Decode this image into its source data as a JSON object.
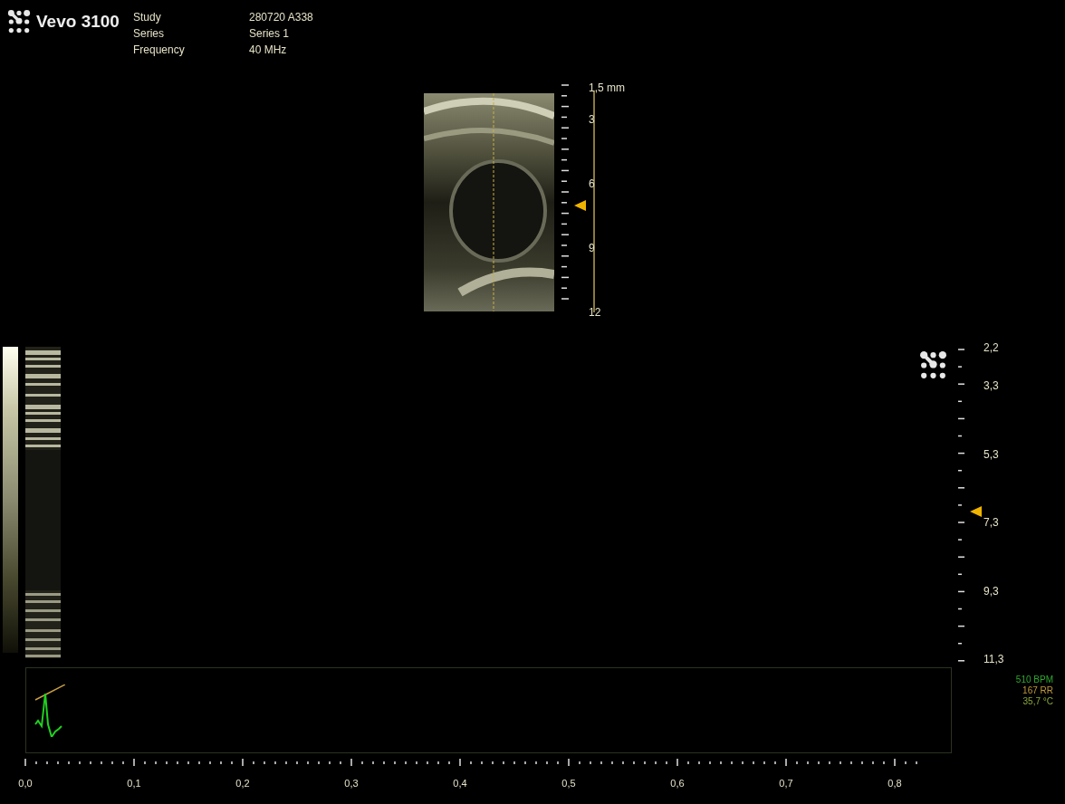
{
  "header": {
    "product": "Vevo",
    "model": "3100",
    "fields": [
      {
        "label": "Study",
        "value": "280720 A338"
      },
      {
        "label": "Series",
        "value": "Series 1"
      },
      {
        "label": "Frequency",
        "value": "40 MHz"
      }
    ]
  },
  "bmode": {
    "depth_labels": [
      "1,5 mm",
      "3",
      "6",
      "9",
      "12"
    ]
  },
  "mmode": {
    "depth_labels": [
      "2,2",
      "3,3",
      "5,3",
      "7,3",
      "9,3",
      "11,3"
    ]
  },
  "vitals": [
    {
      "text": "510 BPM",
      "color": "#2fa82f"
    },
    {
      "text": "167 RR",
      "color": "#c09a3a"
    },
    {
      "text": "35,7 °C",
      "color": "#8aa838"
    }
  ],
  "time_axis": {
    "labels": [
      "0,0",
      "0,1",
      "0,2",
      "0,3",
      "0,4",
      "0,5",
      "0,6",
      "0,7",
      "0,8"
    ]
  }
}
